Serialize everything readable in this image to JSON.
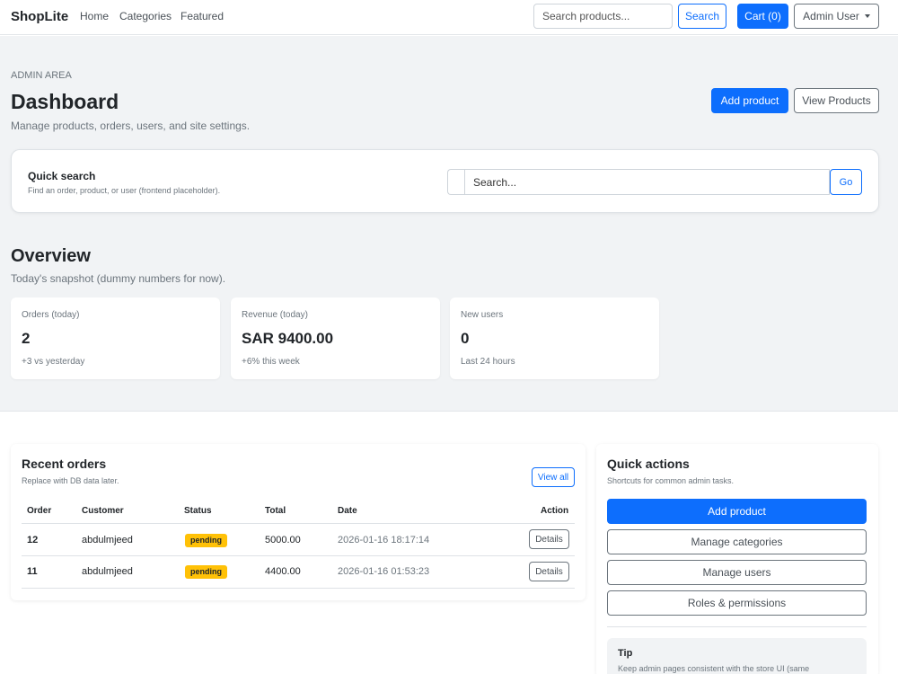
{
  "navbar": {
    "brand": "ShopLite",
    "links": [
      "Home",
      "Categories",
      "Featured"
    ],
    "search_placeholder": "Search products...",
    "search_button": "Search",
    "cart_button": "Cart (0)",
    "user_menu": "Admin User"
  },
  "header": {
    "eyebrow": "ADMIN AREA",
    "title": "Dashboard",
    "subtitle": "Manage products, orders, users, and site settings.",
    "add_product": "Add product",
    "view_products": "View Products"
  },
  "quick_search": {
    "title": "Quick search",
    "subtitle": "Find an order, product, or user (frontend placeholder).",
    "placeholder": "Search...",
    "go": "Go"
  },
  "overview": {
    "title": "Overview",
    "subtitle": "Today's snapshot (dummy numbers for now).",
    "stats": [
      {
        "label": "Orders (today)",
        "value": "2",
        "note": "+3 vs yesterday"
      },
      {
        "label": "Revenue (today)",
        "value": "SAR 9400.00",
        "note": "+6% this week"
      },
      {
        "label": "New users",
        "value": "0",
        "note": "Last 24 hours"
      }
    ]
  },
  "recent_orders": {
    "title": "Recent orders",
    "subtitle": "Replace with DB data later.",
    "view_all": "View all",
    "columns": [
      "Order",
      "Customer",
      "Status",
      "Total",
      "Date",
      "Action"
    ],
    "rows": [
      {
        "order": "12",
        "customer": "abdulmjeed",
        "status": "pending",
        "total": "5000.00",
        "date": "2026-01-16 18:17:14",
        "action": "Details"
      },
      {
        "order": "11",
        "customer": "abdulmjeed",
        "status": "pending",
        "total": "4400.00",
        "date": "2026-01-16 01:53:23",
        "action": "Details"
      }
    ]
  },
  "quick_actions": {
    "title": "Quick actions",
    "subtitle": "Shortcuts for common admin tasks.",
    "buttons": [
      "Add product",
      "Manage categories",
      "Manage users",
      "Roles & permissions"
    ],
    "tip_title": "Tip",
    "tip_text": "Keep admin pages consistent with the store UI (same"
  },
  "colors": {
    "primary": "#0d6efd",
    "warning": "#ffc107",
    "muted": "#6c757d",
    "hero_bg": "#f1f3f5"
  }
}
